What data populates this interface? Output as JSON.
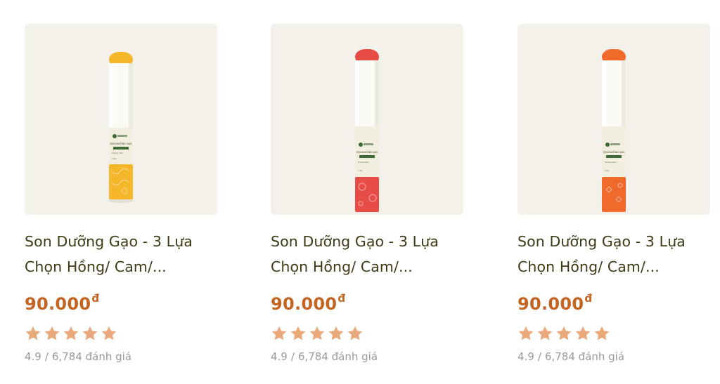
{
  "colors": {
    "card_bg": "#f3f1ea",
    "title": "#3e3a14",
    "price": "#c46420",
    "star": "#eaa97b",
    "rating_text": "#9a9a9a"
  },
  "products": [
    {
      "title_line1": "Son Dưỡng Gạo - 3 Lựa",
      "title_line2": "Chọn Hồng/ Cam/...",
      "price": "90.000",
      "currency": "đ",
      "stars": 5,
      "rating": "4.9",
      "separator": "/",
      "review_count": "6,784 đánh giá",
      "image_icon": "lip-balm-yellow",
      "tint": "#f6b62a",
      "label_title": "SON DƯỠNG GẠO",
      "label_variant": "Không màu",
      "label_weight": "3.5g"
    },
    {
      "title_line1": "Son Dưỡng Gạo - 3 Lựa",
      "title_line2": "Chọn Hồng/ Cam/...",
      "price": "90.000",
      "currency": "đ",
      "stars": 5,
      "rating": "4.9",
      "separator": "/",
      "review_count": "6,784 đánh giá",
      "image_icon": "lip-balm-pink",
      "tint": "#e74c47",
      "label_title": "SON DƯỠNG GẠO",
      "label_variant": "Hương Dâu",
      "label_weight": "3.5g"
    },
    {
      "title_line1": "Son Dưỡng Gạo - 3 Lựa",
      "title_line2": "Chọn Hồng/ Cam/...",
      "price": "90.000",
      "currency": "đ",
      "stars": 5,
      "rating": "4.9",
      "separator": "/",
      "review_count": "6,784 đánh giá",
      "image_icon": "lip-balm-orange",
      "tint": "#f06a2c",
      "label_title": "SON DƯỠNG GẠO",
      "label_variant": "Hương Cam",
      "label_weight": "3.5g"
    }
  ]
}
